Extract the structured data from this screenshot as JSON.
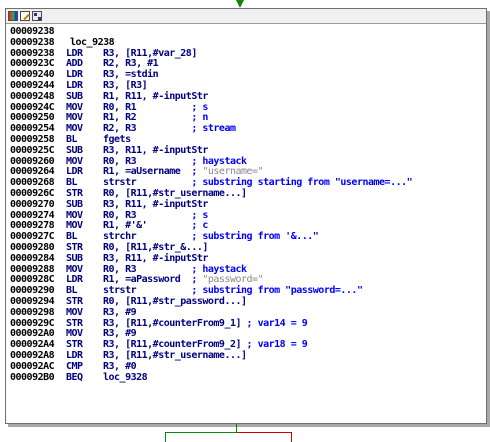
{
  "toolbar": {
    "icons": [
      "color-palette-icon",
      "edit-node-icon",
      "graph-overview-icon"
    ]
  },
  "lines": [
    {
      "addr": "00009238"
    },
    {
      "addr": "00009238",
      "label": "loc_9238"
    },
    {
      "addr": "00009238",
      "mn": "LDR",
      "ops": "R3, [R11,#var_28]"
    },
    {
      "addr": "0000923C",
      "mn": "ADD",
      "ops": "R2, R3, #1"
    },
    {
      "addr": "00009240",
      "mn": "LDR",
      "ops": "R3, =stdin"
    },
    {
      "addr": "00009244",
      "mn": "LDR",
      "ops": "R3, [R3]"
    },
    {
      "addr": "00009248",
      "mn": "SUB",
      "ops": "R1, R11, #-inputStr"
    },
    {
      "addr": "0000924C",
      "mn": "MOV",
      "ops": "R0, R1          ",
      "com": "; s"
    },
    {
      "addr": "00009250",
      "mn": "MOV",
      "ops": "R1, R2          ",
      "com": "; n"
    },
    {
      "addr": "00009254",
      "mn": "MOV",
      "ops": "R2, R3          ",
      "com": "; stream"
    },
    {
      "addr": "00009258",
      "mn": "BL",
      "ops": "fgets"
    },
    {
      "addr": "0000925C",
      "mn": "SUB",
      "ops": "R3, R11, #-inputStr"
    },
    {
      "addr": "00009260",
      "mn": "MOV",
      "ops": "R0, R3          ",
      "com": "; haystack"
    },
    {
      "addr": "00009264",
      "mn": "LDR",
      "ops": "R1, =aUsername  ",
      "com": "; ",
      "str": "\"username=\""
    },
    {
      "addr": "00009268",
      "mn": "BL",
      "ops": "strstr          ",
      "com": "; substring starting from \"username=...\""
    },
    {
      "addr": "0000926C",
      "mn": "STR",
      "ops": "R0, [R11,#str_username...]"
    },
    {
      "addr": "00009270",
      "mn": "SUB",
      "ops": "R3, R11, #-inputStr"
    },
    {
      "addr": "00009274",
      "mn": "MOV",
      "ops": "R0, R3          ",
      "com": "; s"
    },
    {
      "addr": "00009278",
      "mn": "MOV",
      "ops": "R1, #'&'        ",
      "com": "; c"
    },
    {
      "addr": "0000927C",
      "mn": "BL",
      "ops": "strchr          ",
      "com": "; substring from '&...\""
    },
    {
      "addr": "00009280",
      "mn": "STR",
      "ops": "R0, [R11,#str_&...]"
    },
    {
      "addr": "00009284",
      "mn": "SUB",
      "ops": "R3, R11, #-inputStr"
    },
    {
      "addr": "00009288",
      "mn": "MOV",
      "ops": "R0, R3          ",
      "com": "; haystack"
    },
    {
      "addr": "0000928C",
      "mn": "LDR",
      "ops": "R1, =aPassword  ",
      "com": "; ",
      "str": "\"password=\""
    },
    {
      "addr": "00009290",
      "mn": "BL",
      "ops": "strstr          ",
      "com": "; substring from \"password=...\""
    },
    {
      "addr": "00009294",
      "mn": "STR",
      "ops": "R0, [R11,#str_password...]"
    },
    {
      "addr": "00009298",
      "mn": "MOV",
      "ops": "R3, #9"
    },
    {
      "addr": "0000929C",
      "mn": "STR",
      "ops": "R3, [R11,#counterFrom9_1] ",
      "com": "; var14 = 9"
    },
    {
      "addr": "000092A0",
      "mn": "MOV",
      "ops": "R3, #9"
    },
    {
      "addr": "000092A4",
      "mn": "STR",
      "ops": "R3, [R11,#counterFrom9_2] ",
      "com": "; var18 = 9"
    },
    {
      "addr": "000092A8",
      "mn": "LDR",
      "ops": "R3, [R11,#str_username...]"
    },
    {
      "addr": "000092AC",
      "mn": "CMP",
      "ops": "R3, #0"
    },
    {
      "addr": "000092B0",
      "mn": "BEQ",
      "ops": "loc_9328"
    }
  ],
  "colors": {
    "true_edge": "#0a8a0a",
    "false_edge": "#d00000",
    "address": "#000000",
    "instruction": "#000080",
    "comment": "#0000ff",
    "string_literal": "#8a8a8a"
  }
}
